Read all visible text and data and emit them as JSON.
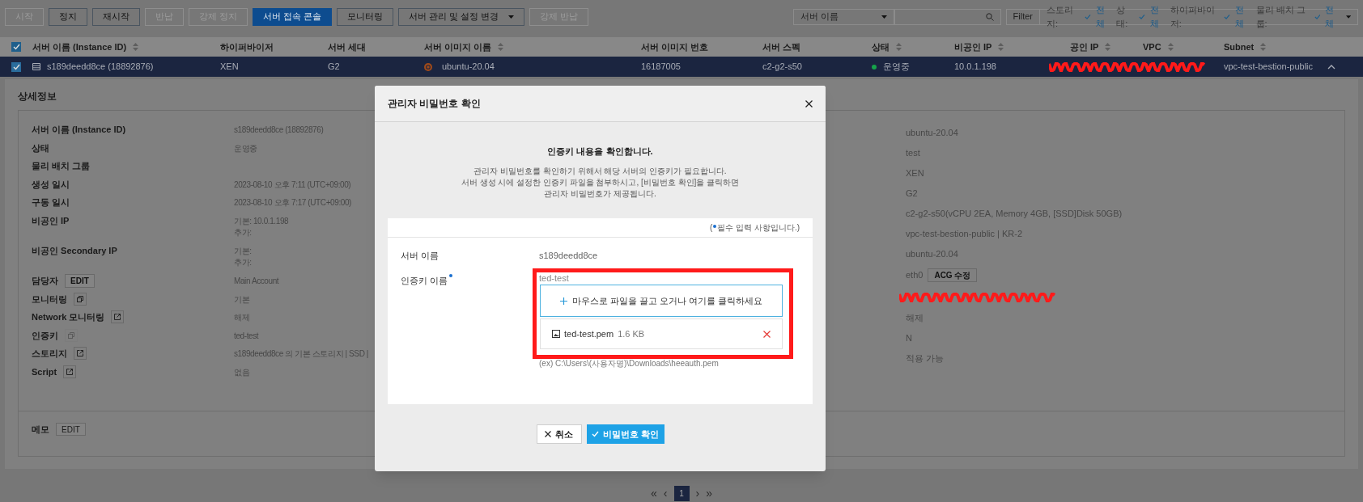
{
  "toolbar": {
    "buttons": [
      {
        "label": "시작",
        "disabled": true,
        "kind": "plain"
      },
      {
        "label": "정지",
        "disabled": false,
        "kind": "plain"
      },
      {
        "label": "재시작",
        "disabled": false,
        "kind": "plain"
      },
      {
        "label": "반납",
        "disabled": true,
        "kind": "plain"
      },
      {
        "label": "강제 정지",
        "disabled": true,
        "kind": "plain"
      },
      {
        "label": "서버 접속 콘솔",
        "disabled": false,
        "kind": "primary"
      },
      {
        "label": "모니터링",
        "disabled": false,
        "kind": "plain"
      },
      {
        "label": "서버 관리 및 설정 변경",
        "disabled": false,
        "kind": "dropdown"
      },
      {
        "label": "강제 반납",
        "disabled": true,
        "kind": "plain"
      }
    ],
    "search_select": "서버 이름",
    "filter_button": "Filter",
    "filters": [
      {
        "label": "스토리지:",
        "value": "전체"
      },
      {
        "label": "상태:",
        "value": "전체"
      },
      {
        "label": "하이퍼바이저:",
        "value": "전체"
      },
      {
        "label": "물리 배치 그룹:",
        "value": "전체"
      }
    ]
  },
  "table": {
    "all_checked": true,
    "columns": [
      {
        "label": "서버 이름 (Instance ID)",
        "sortable": true
      },
      {
        "label": "하이퍼바이저",
        "sortable": false
      },
      {
        "label": "서버 세대",
        "sortable": false
      },
      {
        "label": "서버 이미지 이름",
        "sortable": true
      },
      {
        "label": "서버 이미지 번호",
        "sortable": false
      },
      {
        "label": "서버 스펙",
        "sortable": false
      },
      {
        "label": "상태",
        "sortable": true
      },
      {
        "label": "비공인 IP",
        "sortable": true
      },
      {
        "label": "공인 IP",
        "sortable": true
      },
      {
        "label": "VPC",
        "sortable": true
      },
      {
        "label": "Subnet",
        "sortable": true
      }
    ],
    "rows": [
      {
        "checked": true,
        "selected": true,
        "expanded": true,
        "name": "s189deedd8ce (18892876)",
        "hypervisor": "XEN",
        "generation": "G2",
        "image_name": "ubuntu-20.04",
        "image_no": "16187005",
        "spec": "c2-g2-s50",
        "status": "운영중",
        "color": "#16a34a",
        "private_ip": "10.0.1.198",
        "subnet": "vpc-test-bestion-public"
      }
    ]
  },
  "details": {
    "title": "상세정보",
    "left": [
      {
        "label": "서버 이름 (Instance ID)",
        "values": [
          "s189deedd8ce (18892876)"
        ]
      },
      {
        "label": "상태",
        "values": [
          "운영중"
        ]
      },
      {
        "label": "물리 배치 그룹"
      },
      {
        "label": "생성 일시",
        "values": [
          "2023-08-10 오후 7:11 (UTC+09:00)"
        ]
      },
      {
        "label": "구동 일시",
        "values": [
          "2023-08-10 오후 7:17 (UTC+09:00)"
        ]
      },
      {
        "label": "비공인 IP",
        "values": [
          "기본: 10.0.1.198",
          "추가:"
        ]
      },
      {
        "label": "비공인 Secondary IP",
        "values": [
          "기본:",
          "추가:"
        ]
      },
      {
        "label": "담당자",
        "kind": "edit",
        "action_label": "EDIT",
        "values": [
          "Main Account"
        ]
      },
      {
        "label": "모니터링",
        "kind": "copy",
        "action_disabled": false,
        "values": [
          "기본"
        ]
      },
      {
        "label": "Network 모니터링",
        "kind": "link",
        "values": [
          "해제"
        ]
      },
      {
        "label": "인증키",
        "kind": "copy",
        "action_disabled": true,
        "values": [
          "ted-test"
        ]
      },
      {
        "label": "스토리지",
        "kind": "link",
        "values": [
          "s189deedd8ce 의 기본 스토리지 | SSD |"
        ]
      },
      {
        "label": "Script",
        "kind": "link",
        "values": [
          "없음"
        ]
      }
    ],
    "right": [
      {
        "kind": "text",
        "value": "ubuntu-20.04"
      },
      {
        "kind": "text",
        "value": "test"
      },
      {
        "kind": "text",
        "value": "XEN"
      },
      {
        "kind": "text",
        "value": "G2"
      },
      {
        "kind": "text",
        "value": "c2-g2-s50(vCPU 2EA, Memory 4GB, [SSD]Disk 50GB)"
      },
      {
        "kind": "text",
        "value": "vpc-test-bestion-public | KR-2"
      },
      {
        "kind": "text",
        "value": "ubuntu-20.04"
      },
      {
        "kind": "button",
        "value": "eth0",
        "button": "ACG 수정"
      },
      {
        "kind": "redacted"
      },
      {
        "kind": "text",
        "value": "해제"
      },
      {
        "kind": "text",
        "value": "N"
      },
      {
        "kind": "text",
        "value": "적용 가능"
      }
    ],
    "memo": {
      "label": "메모",
      "button": "EDIT"
    }
  },
  "pagination": {
    "first": "«",
    "previous": "‹",
    "next": "›",
    "last": "»",
    "pages": [
      {
        "label": "1",
        "selected": true
      }
    ]
  },
  "modal": {
    "title": "관리자 비밀번호 확인",
    "heading": "인증키 내용을 확인합니다.",
    "description": [
      "관리자 비밀번호를 확인하기 위해서 해당 서버의 인증키가 필요합니다.",
      "서버 생성 시에 설정한 인증키 파일을 첨부하시고, [비밀번호 확인]을 클릭하면",
      "관리자 비밀번호가 제공됩니다."
    ],
    "required_note_open": "(",
    "required_note": "필수 입력 사항입니다.)",
    "server_label": "서버 이름",
    "server_value": "s189deedd8ce",
    "key_label": "인증키 이름",
    "key_required": true,
    "key_value": "ted-test",
    "dropzone": "마우스로 파일을 끌고 오거나 여기를 클릭하세요",
    "file": {
      "name": "ted-test.pem",
      "size": "1.6 KB"
    },
    "example": "(ex) C:\\Users\\(사용자명)\\Downloads\\heeauth.pem",
    "cancel": "취소",
    "confirm": "비밀번호 확인"
  }
}
